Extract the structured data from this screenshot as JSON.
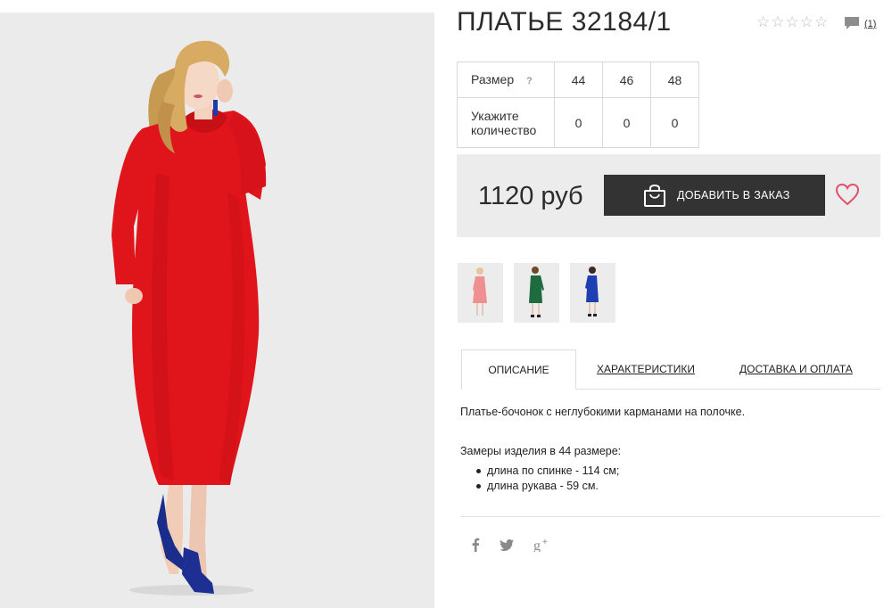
{
  "product": {
    "title": "ПЛАТЬЕ 32184/1",
    "rating_stars": 0,
    "rating_max": 5,
    "reviews_count": "(1)"
  },
  "sizes_table": {
    "size_label": "Размер",
    "size_help": "?",
    "qty_label": "Укажите количество",
    "sizes": [
      "44",
      "46",
      "48"
    ],
    "quantities": [
      "0",
      "0",
      "0"
    ]
  },
  "buy": {
    "price": "1120 руб",
    "order_button": "ДОБАВИТЬ В ЗАКАЗ",
    "order_icon": "shopping-bag-icon",
    "favorite_icon": "heart-icon",
    "accent_color": "#e0506a",
    "button_color": "#333333"
  },
  "color_variants": [
    {
      "name": "pink",
      "color": "#f08f92"
    },
    {
      "name": "green",
      "color": "#1d6b3f"
    },
    {
      "name": "blue",
      "color": "#1e3fb0"
    }
  ],
  "main_photo_dress_color": "#e0141b",
  "tabs": [
    {
      "label": "ОПИСАНИЕ",
      "active": true
    },
    {
      "label": "ХАРАКТЕРИСТИКИ",
      "active": false
    },
    {
      "label": "ДОСТАВКА И ОПЛАТА",
      "active": false
    }
  ],
  "description": {
    "text": "Платье-бочонок с неглубокими карманами на полочке.",
    "measurements_title": "Замеры изделия в 44 размере:",
    "measurements": [
      "длина по спинке - 114 см;",
      "длина рукава - 59 см."
    ]
  },
  "social": [
    "facebook-icon",
    "twitter-icon",
    "google-plus-icon"
  ]
}
